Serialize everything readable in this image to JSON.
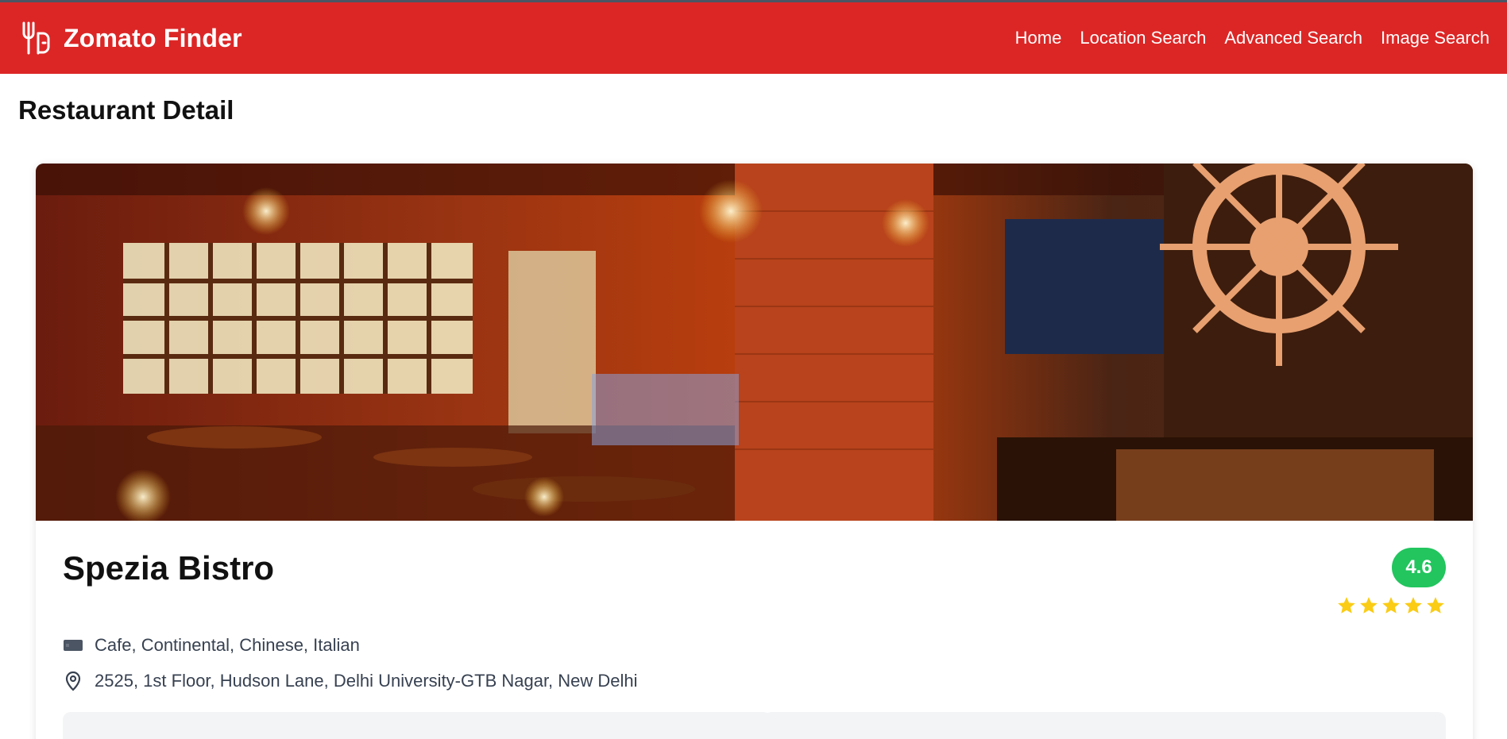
{
  "app": {
    "name": "Zomato Finder",
    "logo_icon": "fork-utensil-icon",
    "brand_color": "#dc2626"
  },
  "nav": {
    "links": [
      {
        "label": "Home"
      },
      {
        "label": "Location Search"
      },
      {
        "label": "Advanced Search"
      },
      {
        "label": "Image Search"
      }
    ]
  },
  "page": {
    "title": "Restaurant Detail"
  },
  "restaurant": {
    "name": "Spezia Bistro",
    "rating": "4.6",
    "rating_color": "#22c55e",
    "stars": 5,
    "star_color": "#facc15",
    "cuisines": "Cafe, Continental, Chinese, Italian",
    "cuisines_icon": "utensils-icon",
    "address": "2525, 1st Floor, Hudson Lane, Delhi University-GTB Nagar, New Delhi",
    "address_icon": "map-pin-icon",
    "image": "restaurant-interior-photo"
  }
}
